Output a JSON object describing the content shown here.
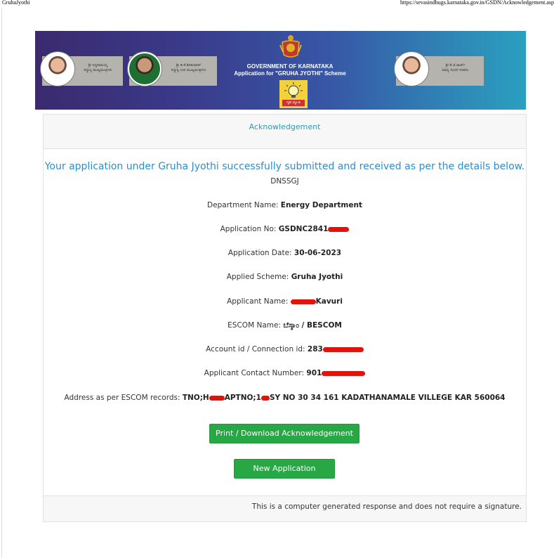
{
  "print_header": {
    "page_title": "GruhaJyothi",
    "url": "https://sevasindhugs.karnataka.gov.in/GSDN/Acknowledgement.asp"
  },
  "banner": {
    "person1_caption": "ಶ್ರೀ ಸಿದ್ದರಾಮಯ್ಯ\nಸನ್ಮಾನ್ಯ ಮುಖ್ಯಮಂತ್ರಿಗಳು",
    "person2_caption": "ಶ್ರೀ ಡಿ.ಕೆ.ಶಿವಕುಮಾರ್\nಸನ್ಮಾನ್ಯ ಉಪ ಮುಖ್ಯಮಂತ್ರಿಗಳು",
    "person3_caption": "ಶ್ರೀ ಕೆ.ಜೆ.ಜಾರ್ಜ್\nಮಾನ್ಯ ಇಂಧನ ಸಚಿವರು",
    "gov_line1": "GOVERNMENT OF KARNATAKA",
    "gov_line2": "Application for \"GRUHA JYOTHI\" Scheme",
    "logo_text": "ಗೃಹ ಜ್ಯೋತಿ"
  },
  "card": {
    "header": "Acknowledgement",
    "success_message": "Your application under Gruha Jyothi successfully submitted and received as per the details below.",
    "code": "DNSSGJ",
    "department_label": "Department Name: ",
    "department_value": "Energy Department",
    "application_no_label": "Application No: ",
    "application_no_value": "GSDNC2841",
    "application_date_label": "Application Date: ",
    "application_date_value": "30-06-2023",
    "scheme_label": "Applied Scheme: ",
    "scheme_value": "Gruha Jyothi",
    "applicant_label": "Applicant Name: ",
    "applicant_value": "Kavuri",
    "escom_label": "ESCOM Name: ",
    "escom_value": "ಬೆಸ್ಕಾಂ / BESCOM",
    "account_label": "Account id / Connection id: ",
    "account_value": "283",
    "contact_label": "Applicant Contact Number: ",
    "contact_value": "901",
    "address_label": "Address as per ESCOM records: ",
    "address_part1": "TNO;H",
    "address_part2": "APTNO;1",
    "address_part3": "SY NO 30 34 161 KADATHANAMALE VILLEGE KAR 560064",
    "print_button": "Print / Download Acknowledgement",
    "new_button": "New Application",
    "footer": "This is a computer generated response and does not require a signature."
  },
  "colors": {
    "accent_blue": "#2a8fd1",
    "header_teal": "#2a9bb5",
    "button_green": "#28a745",
    "redaction_red": "#e3120b"
  }
}
